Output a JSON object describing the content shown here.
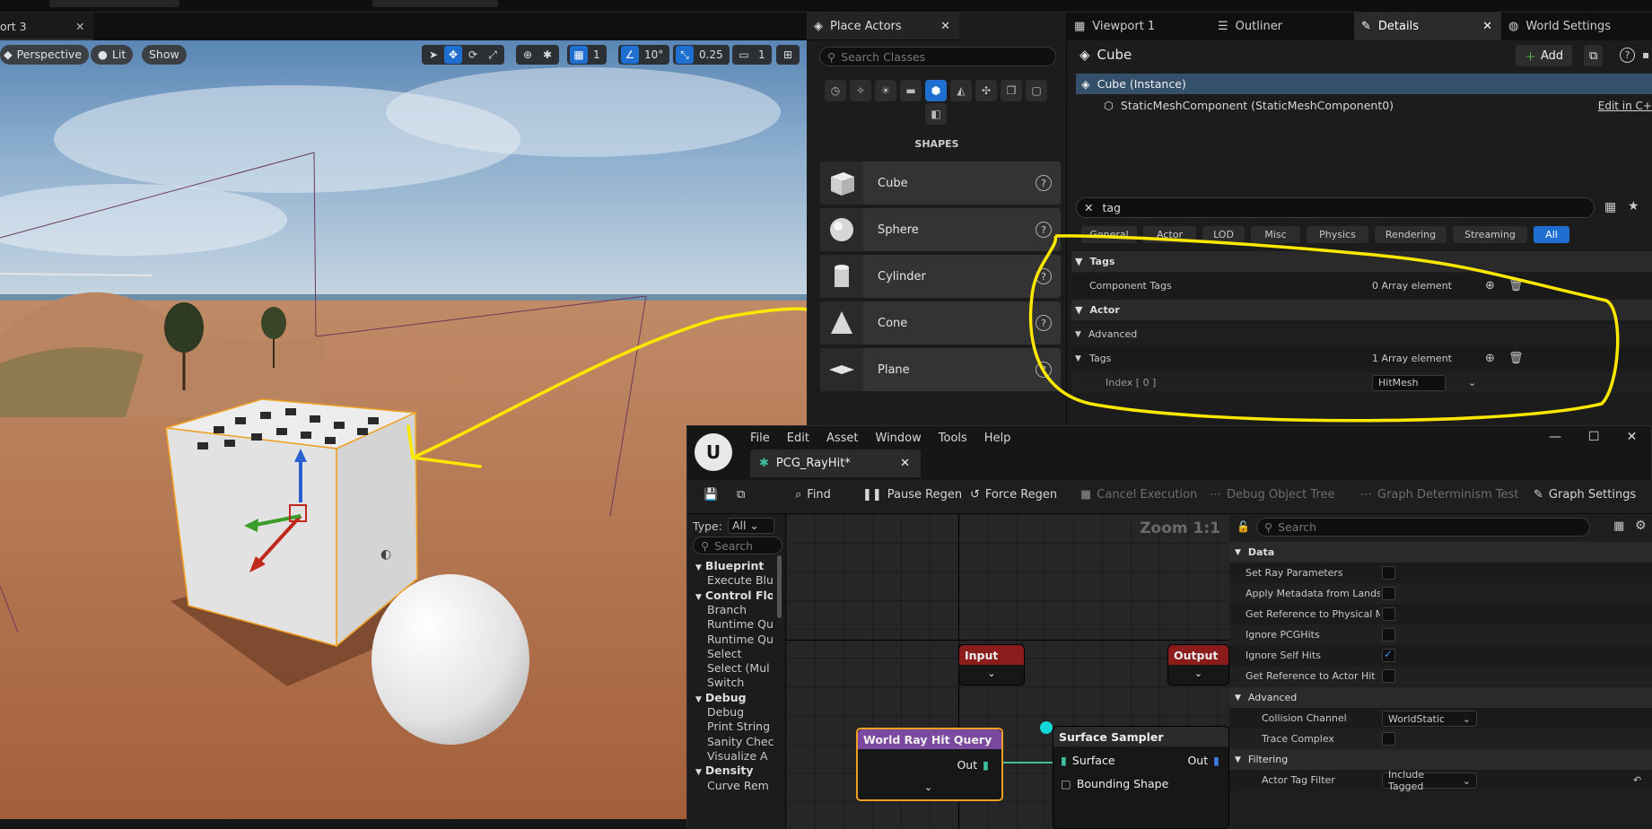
{
  "viewport": {
    "tab_label": "ort 3",
    "mode_label": "Perspective",
    "lit_label": "Lit",
    "show_label": "Show",
    "grid_snap": "1",
    "angle_snap": "10°",
    "scale_snap": "0.25",
    "camera_speed": "1"
  },
  "place_actors": {
    "tab_label": "Place Actors",
    "search_placeholder": "Search Classes",
    "section_title": "SHAPES",
    "items": [
      {
        "label": "Cube"
      },
      {
        "label": "Sphere"
      },
      {
        "label": "Cylinder"
      },
      {
        "label": "Cone"
      },
      {
        "label": "Plane"
      }
    ]
  },
  "details": {
    "tabs": [
      "Viewport 1",
      "Outliner",
      "Details",
      "World Settings"
    ],
    "actor_name": "Cube",
    "add_label": "Add",
    "instance_label": "Cube (Instance)",
    "component_label": "StaticMeshComponent (StaticMeshComponent0)",
    "edit_link": "Edit in C+",
    "search_value": "tag",
    "filters": [
      "General",
      "Actor",
      "LOD",
      "Misc",
      "Physics",
      "Rendering",
      "Streaming",
      "All"
    ],
    "sec_tags": "Tags",
    "component_tags_label": "Component Tags",
    "component_tags_value": "0 Array element",
    "sec_actor": "Actor",
    "advanced_label": "Advanced",
    "tags_label": "Tags",
    "tags_value": "1 Array element",
    "index_label": "Index [ 0 ]",
    "index_value": "HitMesh"
  },
  "pcg": {
    "menu": [
      "File",
      "Edit",
      "Asset",
      "Window",
      "Tools",
      "Help"
    ],
    "tab_label": "PCG_RayHit*",
    "toolbar": {
      "find": "Find",
      "pause": "Pause Regen",
      "force": "Force Regen",
      "cancel": "Cancel Execution",
      "debug_tree": "Debug Object Tree",
      "determinism": "Graph Determinism Test",
      "settings": "Graph Settings"
    },
    "palette": {
      "type_label": "Type:",
      "type_value": "All",
      "search_placeholder": "Search",
      "items": [
        {
          "label": "Blueprint",
          "h": true
        },
        {
          "label": "Execute Blu",
          "h": false
        },
        {
          "label": "Control Flow",
          "h": true
        },
        {
          "label": "Branch",
          "h": false
        },
        {
          "label": "Runtime Qu",
          "h": false
        },
        {
          "label": "Runtime Qu",
          "h": false
        },
        {
          "label": "Select",
          "h": false
        },
        {
          "label": "Select (Mul",
          "h": false
        },
        {
          "label": "Switch",
          "h": false
        },
        {
          "label": "Debug",
          "h": true
        },
        {
          "label": "Debug",
          "h": false
        },
        {
          "label": "Print String",
          "h": false
        },
        {
          "label": "Sanity Chec",
          "h": false
        },
        {
          "label": "Visualize A",
          "h": false
        },
        {
          "label": "Density",
          "h": true
        },
        {
          "label": "Curve Rem",
          "h": false
        }
      ]
    },
    "graph": {
      "zoom": "Zoom 1:1",
      "input_label": "Input",
      "output_label": "Output",
      "ray_node": "World Ray Hit Query",
      "ray_out": "Out",
      "sampler_node": "Surface Sampler",
      "sampler_surface": "Surface",
      "sampler_out": "Out",
      "sampler_bounding": "Bounding Shape"
    },
    "props": {
      "search_placeholder": "Search",
      "sec_data": "Data",
      "rows": [
        {
          "label": "Set Ray Parameters",
          "checked": false
        },
        {
          "label": "Apply Metadata from Landsca...",
          "checked": false
        },
        {
          "label": "Get Reference to Physical Mat...",
          "checked": false
        },
        {
          "label": "Ignore PCGHits",
          "checked": false
        },
        {
          "label": "Ignore Self Hits",
          "checked": true
        },
        {
          "label": "Get Reference to Actor Hit",
          "checked": false
        }
      ],
      "sec_advanced": "Advanced",
      "collision_label": "Collision Channel",
      "collision_value": "WorldStatic",
      "trace_label": "Trace Complex",
      "sec_filtering": "Filtering",
      "actor_tag_label": "Actor Tag Filter",
      "actor_tag_value": "Include Tagged"
    }
  }
}
